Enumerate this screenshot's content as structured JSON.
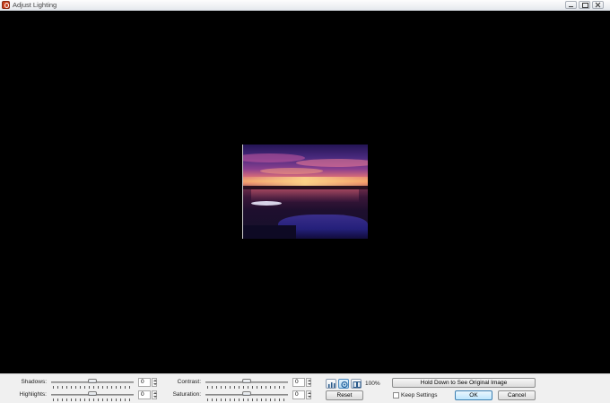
{
  "window": {
    "title": "Adjust Lighting"
  },
  "preview": {
    "description_icon": "image-preview"
  },
  "controls": {
    "shadows": {
      "label": "Shadows:",
      "value": "0",
      "level": 0.5
    },
    "highlights": {
      "label": "Highlights:",
      "value": "0",
      "level": 0.5
    },
    "contrast": {
      "label": "Contrast:",
      "value": "0",
      "level": 0.5
    },
    "saturation": {
      "label": "Saturation:",
      "value": "0",
      "level": 0.5
    }
  },
  "view": {
    "icons": [
      "histogram-icon",
      "view-mode-icon",
      "split-view-icon"
    ],
    "zoom_label": "100%"
  },
  "buttons": {
    "reset": "Reset",
    "hold_original": "Hold Down to See Original Image",
    "ok": "OK",
    "cancel": "Cancel"
  },
  "keep_settings": {
    "label": "Keep Settings",
    "checked": false
  }
}
